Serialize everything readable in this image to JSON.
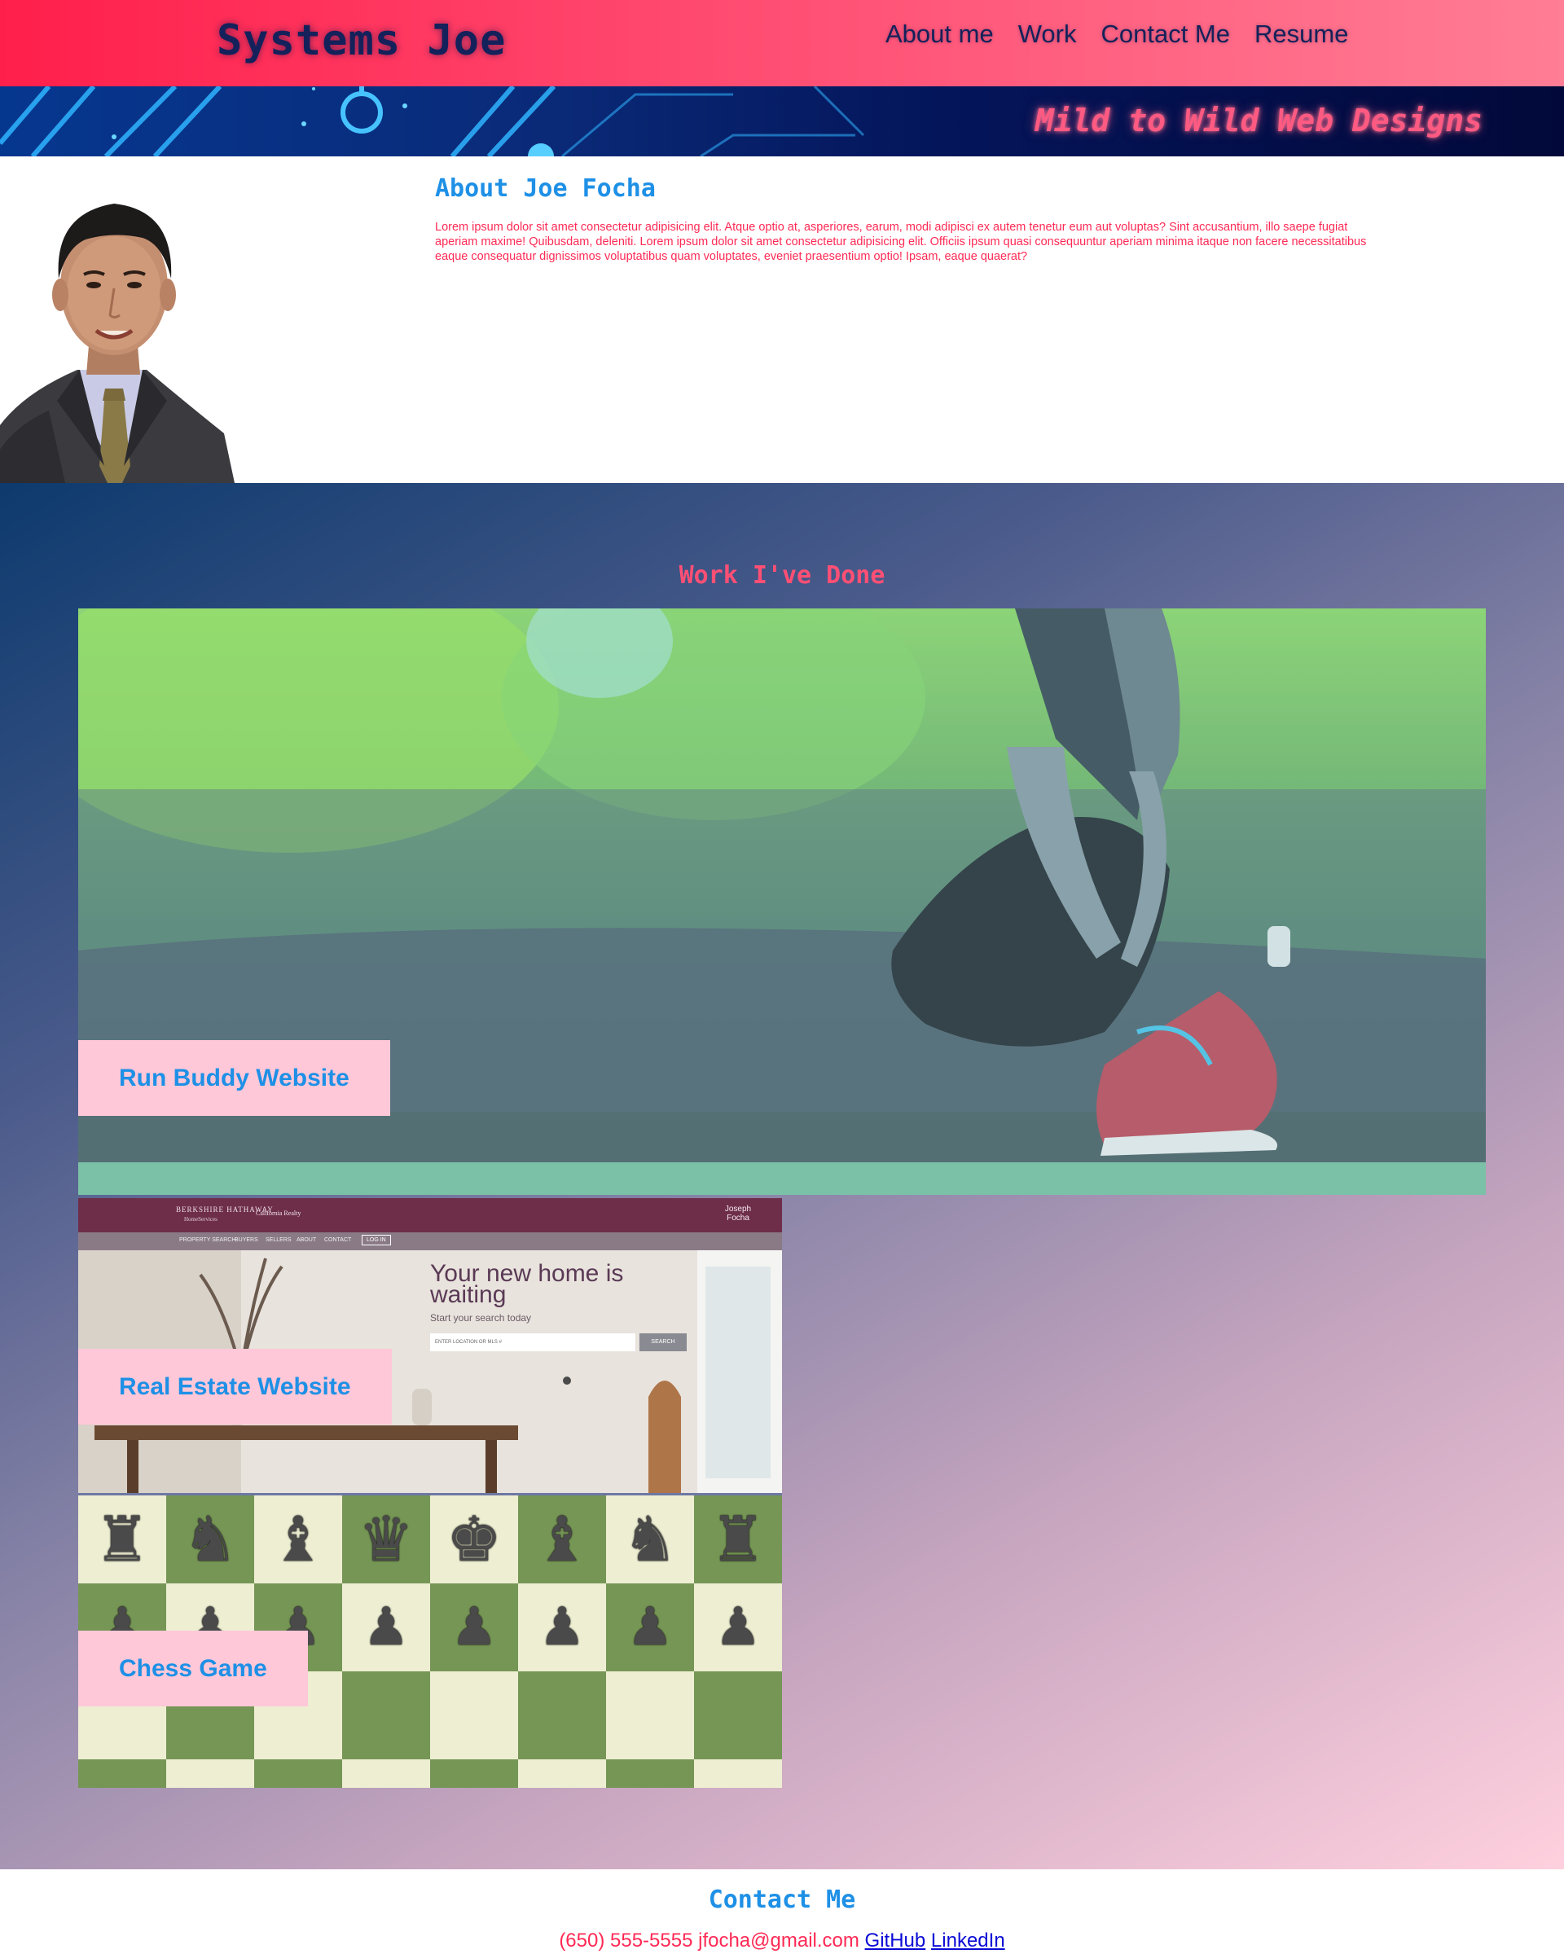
{
  "header": {
    "brand": "Systems Joe",
    "nav": [
      "About me",
      "Work",
      "Contact Me",
      "Resume"
    ]
  },
  "banner": {
    "tagline": "Mild to Wild Web Designs"
  },
  "about": {
    "title": "About Joe Focha",
    "text": "Lorem ipsum dolor sit amet consectetur adipisicing elit. Atque optio at, asperiores, earum, modi adipisci ex autem tenetur eum aut voluptas? Sint accusantium, illo saepe fugiat aperiam maxime! Quibusdam, deleniti. Lorem ipsum dolor sit amet consectetur adipisicing elit. Officiis ipsum quasi consequuntur aperiam minima itaque non facere necessitatibus eaque consequatur dignissimos voluptatibus quam voluptates, eveniet praesentium optio! Ipsam, eaque quaerat?"
  },
  "work": {
    "title": "Work I've Done",
    "projects": [
      {
        "label": "Run Buddy Website"
      },
      {
        "label": "Real Estate Website",
        "screenshot": {
          "logo": "BERKSHIRE HATHAWAY",
          "logo_sub": "HomeServices",
          "agency": "California Realty",
          "agent": "Joseph Focha",
          "nav": [
            "PROPERTY SEARCH",
            "BUYERS",
            "SELLERS",
            "ABOUT",
            "CONTACT",
            "LOG IN"
          ],
          "headline": "Your new home is waiting",
          "subline": "Start your search today",
          "search_placeholder": "ENTER LOCATION OR MLS #",
          "search_button": "SEARCH"
        }
      },
      {
        "label": "Chess Game"
      }
    ]
  },
  "footer": {
    "title": "Contact Me",
    "phone": "(650) 555-5555",
    "email": "jfocha@gmail.com",
    "links": [
      "GitHub",
      "LinkedIn"
    ]
  },
  "colors": {
    "header_start": "#ff1f4b",
    "header_end": "#ff7d95",
    "navy": "#15215a",
    "accent_blue": "#1e90e6",
    "accent_pink": "#ff4f74",
    "label_bg": "#ffc8d8",
    "chess_green": "#769656",
    "chess_cream": "#eeeed2"
  },
  "chess": {
    "back_rank": [
      "rook",
      "knight",
      "bishop",
      "queen",
      "king",
      "bishop",
      "knight",
      "rook"
    ],
    "pawn_rank": [
      "pawn",
      "pawn",
      "pawn",
      "pawn",
      "pawn",
      "pawn",
      "pawn",
      "pawn"
    ]
  }
}
